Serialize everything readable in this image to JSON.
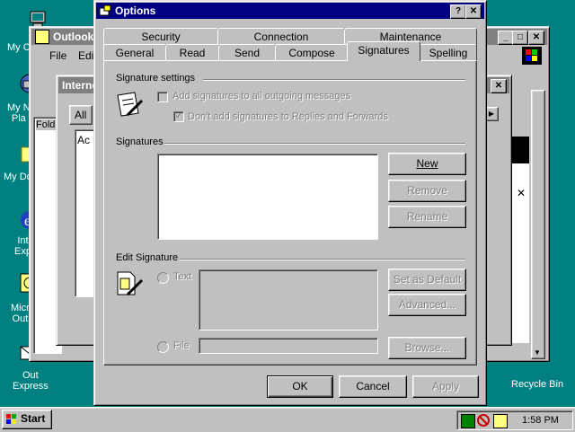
{
  "desktop": {
    "icons": [
      {
        "label": "My C"
      },
      {
        "label": "My N\nPla"
      },
      {
        "label": "My Do"
      },
      {
        "label": "Int\nExp"
      },
      {
        "label": "Micr\nOut"
      },
      {
        "label": "Out\nExpress"
      },
      {
        "label": "Recycle Bin"
      }
    ]
  },
  "outlook": {
    "title": "Outlook",
    "menu_file": "File",
    "menu_edit": "Edit",
    "folder_label": "Fold"
  },
  "internet": {
    "title": "Interne",
    "tab_all": "All",
    "col_ac": "Ac"
  },
  "options": {
    "title": "Options",
    "tabs_top": [
      "Security",
      "Connection",
      "Maintenance"
    ],
    "tabs_bottom": [
      "General",
      "Read",
      "Send",
      "Compose",
      "Signatures",
      "Spelling"
    ],
    "sig_settings_group": "Signature settings",
    "chk_add_all": "Add signatures to all outgoing messages",
    "chk_dont_add": "Don't add signatures to Replies and Forwards",
    "signatures_group": "Signatures",
    "btn_new": "New",
    "btn_remove": "Remove",
    "btn_rename": "Rename",
    "edit_sig_group": "Edit Signature",
    "radio_text": "Text",
    "radio_file": "File",
    "btn_set_default": "Set as Default",
    "btn_advanced": "Advanced...",
    "btn_browse": "Browse...",
    "btn_ok": "OK",
    "btn_cancel": "Cancel",
    "btn_apply": "Apply"
  },
  "taskbar": {
    "start": "Start",
    "clock": "1:58 PM"
  }
}
